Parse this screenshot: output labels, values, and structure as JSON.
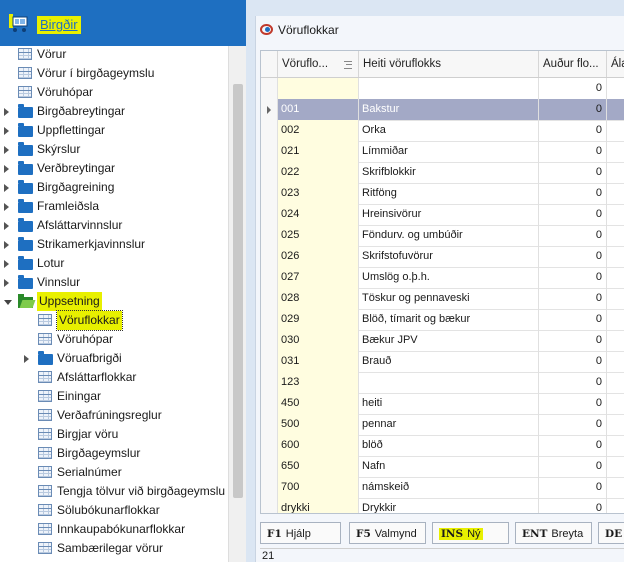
{
  "app": {
    "title": "Birgðir"
  },
  "tree": [
    {
      "label": "Vörur",
      "level": 0,
      "icon": "table-icon"
    },
    {
      "label": "Vörur í birgðageymslu",
      "level": 0,
      "icon": "table-icon"
    },
    {
      "label": "Vöruhópar",
      "level": 0,
      "icon": "table-icon"
    },
    {
      "label": "Birgðabreytingar",
      "level": 0,
      "icon": "folder-icon",
      "expand": "closed"
    },
    {
      "label": "Uppflettingar",
      "level": 0,
      "icon": "folder-icon",
      "expand": "closed"
    },
    {
      "label": "Skýrslur",
      "level": 0,
      "icon": "folder-icon",
      "expand": "closed"
    },
    {
      "label": "Verðbreytingar",
      "level": 0,
      "icon": "folder-icon",
      "expand": "closed"
    },
    {
      "label": "Birgðagreining",
      "level": 0,
      "icon": "folder-icon",
      "expand": "closed"
    },
    {
      "label": "Framleiðsla",
      "level": 0,
      "icon": "folder-icon",
      "expand": "closed"
    },
    {
      "label": "Afsláttarvinnslur",
      "level": 0,
      "icon": "folder-icon",
      "expand": "closed"
    },
    {
      "label": "Strikamerkjavinnslur",
      "level": 0,
      "icon": "folder-icon",
      "expand": "closed"
    },
    {
      "label": "Lotur",
      "level": 0,
      "icon": "folder-icon",
      "expand": "closed"
    },
    {
      "label": "Vinnslur",
      "level": 0,
      "icon": "folder-icon",
      "expand": "closed"
    },
    {
      "label": "Uppsetning",
      "level": 0,
      "icon": "folder-open-icon",
      "expand": "open",
      "highlight": true
    },
    {
      "label": "Vöruflokkar",
      "level": 1,
      "icon": "table-icon",
      "selected": true
    },
    {
      "label": "Vöruhópar",
      "level": 1,
      "icon": "table-icon"
    },
    {
      "label": "Vöruafbrigði",
      "level": 1,
      "icon": "folder-icon",
      "expand": "closed"
    },
    {
      "label": "Afsláttarflokkar",
      "level": 1,
      "icon": "table-icon"
    },
    {
      "label": "Einingar",
      "level": 1,
      "icon": "table-icon"
    },
    {
      "label": "Verðafrúningsreglur",
      "level": 1,
      "icon": "table-icon"
    },
    {
      "label": "Birgjar vöru",
      "level": 1,
      "icon": "table-icon"
    },
    {
      "label": "Birgðageymslur",
      "level": 1,
      "icon": "table-icon"
    },
    {
      "label": "Serialnúmer",
      "level": 1,
      "icon": "table-icon"
    },
    {
      "label": "Tengja tölvur við birgðageymslu",
      "level": 1,
      "icon": "table-icon"
    },
    {
      "label": "Sölubókunarflokkar",
      "level": 1,
      "icon": "table-icon"
    },
    {
      "label": "Innkaupabókunarflokkar",
      "level": 1,
      "icon": "table-icon"
    },
    {
      "label": "Sambærilegar vörur",
      "level": 1,
      "icon": "table-icon"
    }
  ],
  "window": {
    "title": "Vöruflokkar"
  },
  "grid": {
    "columns": [
      "Vöruflo...",
      "Heiti vöruflokks",
      "Auður flo...",
      "Ála"
    ],
    "rows": [
      {
        "code": "",
        "name": "",
        "value": "0"
      },
      {
        "code": "001",
        "name": "Bakstur",
        "value": "0",
        "current": true
      },
      {
        "code": "002",
        "name": "Orka",
        "value": "0"
      },
      {
        "code": "021",
        "name": "Límmiðar",
        "value": "0"
      },
      {
        "code": "022",
        "name": "Skrifblokkir",
        "value": "0"
      },
      {
        "code": "023",
        "name": "Ritföng",
        "value": "0"
      },
      {
        "code": "024",
        "name": "Hreinsivörur",
        "value": "0"
      },
      {
        "code": "025",
        "name": "Föndurv. og umbúðir",
        "value": "0"
      },
      {
        "code": "026",
        "name": "Skrifstofuvörur",
        "value": "0"
      },
      {
        "code": "027",
        "name": "Umslög o.þ.h.",
        "value": "0"
      },
      {
        "code": "028",
        "name": "Töskur og pennaveski",
        "value": "0"
      },
      {
        "code": "029",
        "name": "Blöð, tímarit og bækur",
        "value": "0"
      },
      {
        "code": "030",
        "name": "Bækur JPV",
        "value": "0"
      },
      {
        "code": "031",
        "name": "Brauð",
        "value": "0"
      },
      {
        "code": "123",
        "name": "",
        "value": "0"
      },
      {
        "code": "450",
        "name": "heiti",
        "value": "0"
      },
      {
        "code": "500",
        "name": "pennar",
        "value": "0"
      },
      {
        "code": "600",
        "name": "blöð",
        "value": "0"
      },
      {
        "code": "650",
        "name": "Nafn",
        "value": "0"
      },
      {
        "code": "700",
        "name": "námskeið",
        "value": "0"
      },
      {
        "code": "drykki",
        "name": "Drykkir",
        "value": "0"
      }
    ]
  },
  "buttons": [
    {
      "key": "F1",
      "label": "Hjálp"
    },
    {
      "key": "F5",
      "label": "Valmynd"
    },
    {
      "key": "INS",
      "label": "Ný",
      "highlight": true
    },
    {
      "key": "ENT",
      "label": "Breyta"
    },
    {
      "key": "DE",
      "label": ""
    }
  ],
  "status": {
    "count": "21"
  },
  "colors": {
    "header": "#1e6fc1",
    "highlight": "#e8f000",
    "current_row": "#a3a9c6",
    "code_cell": "#fffde0"
  }
}
